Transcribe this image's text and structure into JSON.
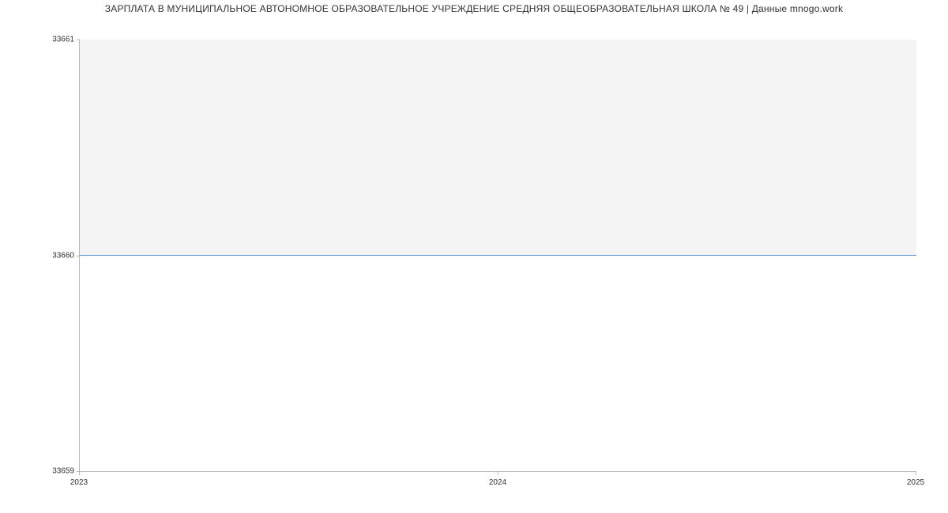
{
  "chart_data": {
    "type": "line",
    "title": "ЗАРПЛАТА В МУНИЦИПАЛЬНОЕ АВТОНОМНОЕ ОБРАЗОВАТЕЛЬНОЕ УЧРЕЖДЕНИЕ СРЕДНЯЯ ОБЩЕОБРАЗОВАТЕЛЬНАЯ ШКОЛА № 49 | Данные mnogo.work",
    "x": [
      2023,
      2024,
      2025
    ],
    "series": [
      {
        "name": "salary",
        "values": [
          33660,
          33660,
          33660
        ]
      }
    ],
    "xlabel": "",
    "ylabel": "",
    "xlim": [
      2023,
      2025
    ],
    "ylim": [
      33659,
      33661
    ],
    "x_ticks": [
      2023,
      2024,
      2025
    ],
    "y_ticks": [
      33659,
      33660,
      33661
    ],
    "line_color": "#5a8fd6",
    "plot_bg": "#f4f4f4"
  },
  "axis": {
    "y_top": "33661",
    "y_mid": "33660",
    "y_bot": "33659",
    "x_left": "2023",
    "x_mid": "2024",
    "x_right": "2025"
  }
}
